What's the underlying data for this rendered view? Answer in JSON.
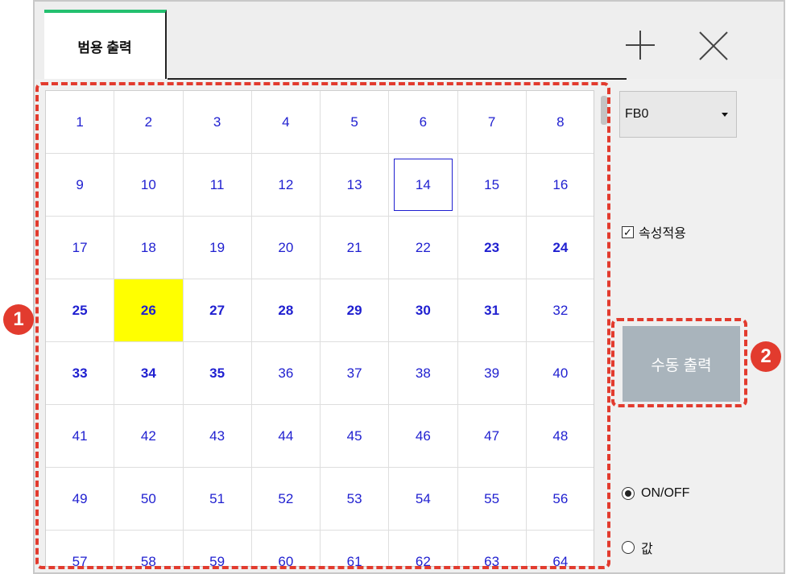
{
  "tab": {
    "label": "범용 출력"
  },
  "dropdown": {
    "value": "FB0"
  },
  "checkbox": {
    "label": "속성적용",
    "checked": true
  },
  "manual_button": {
    "label": "수동 출력"
  },
  "radios": [
    {
      "label": "ON/OFF",
      "selected": true
    },
    {
      "label": "값",
      "selected": false
    }
  ],
  "badges": [
    "1",
    "2"
  ],
  "grid": {
    "cells": [
      "1",
      "2",
      "3",
      "4",
      "5",
      "6",
      "7",
      "8",
      "9",
      "10",
      "11",
      "12",
      "13",
      "14",
      "15",
      "16",
      "17",
      "18",
      "19",
      "20",
      "21",
      "22",
      "23",
      "24",
      "25",
      "26",
      "27",
      "28",
      "29",
      "30",
      "31",
      "32",
      "33",
      "34",
      "35",
      "36",
      "37",
      "38",
      "39",
      "40",
      "41",
      "42",
      "43",
      "44",
      "45",
      "46",
      "47",
      "48",
      "49",
      "50",
      "51",
      "52",
      "53",
      "54",
      "55",
      "56",
      "57",
      "58",
      "59",
      "60",
      "61",
      "62",
      "63",
      "64"
    ],
    "bold": [
      "23",
      "24",
      "25",
      "26",
      "27",
      "28",
      "29",
      "30",
      "31",
      "33",
      "34",
      "35"
    ],
    "highlighted": "26",
    "selected": "14",
    "highlight_color": "#ffff00",
    "text_color": "#1f1fd0"
  },
  "colors": {
    "accent": "#23c06f",
    "annotation": "#e23b2e",
    "button": "#a9b4bc"
  }
}
